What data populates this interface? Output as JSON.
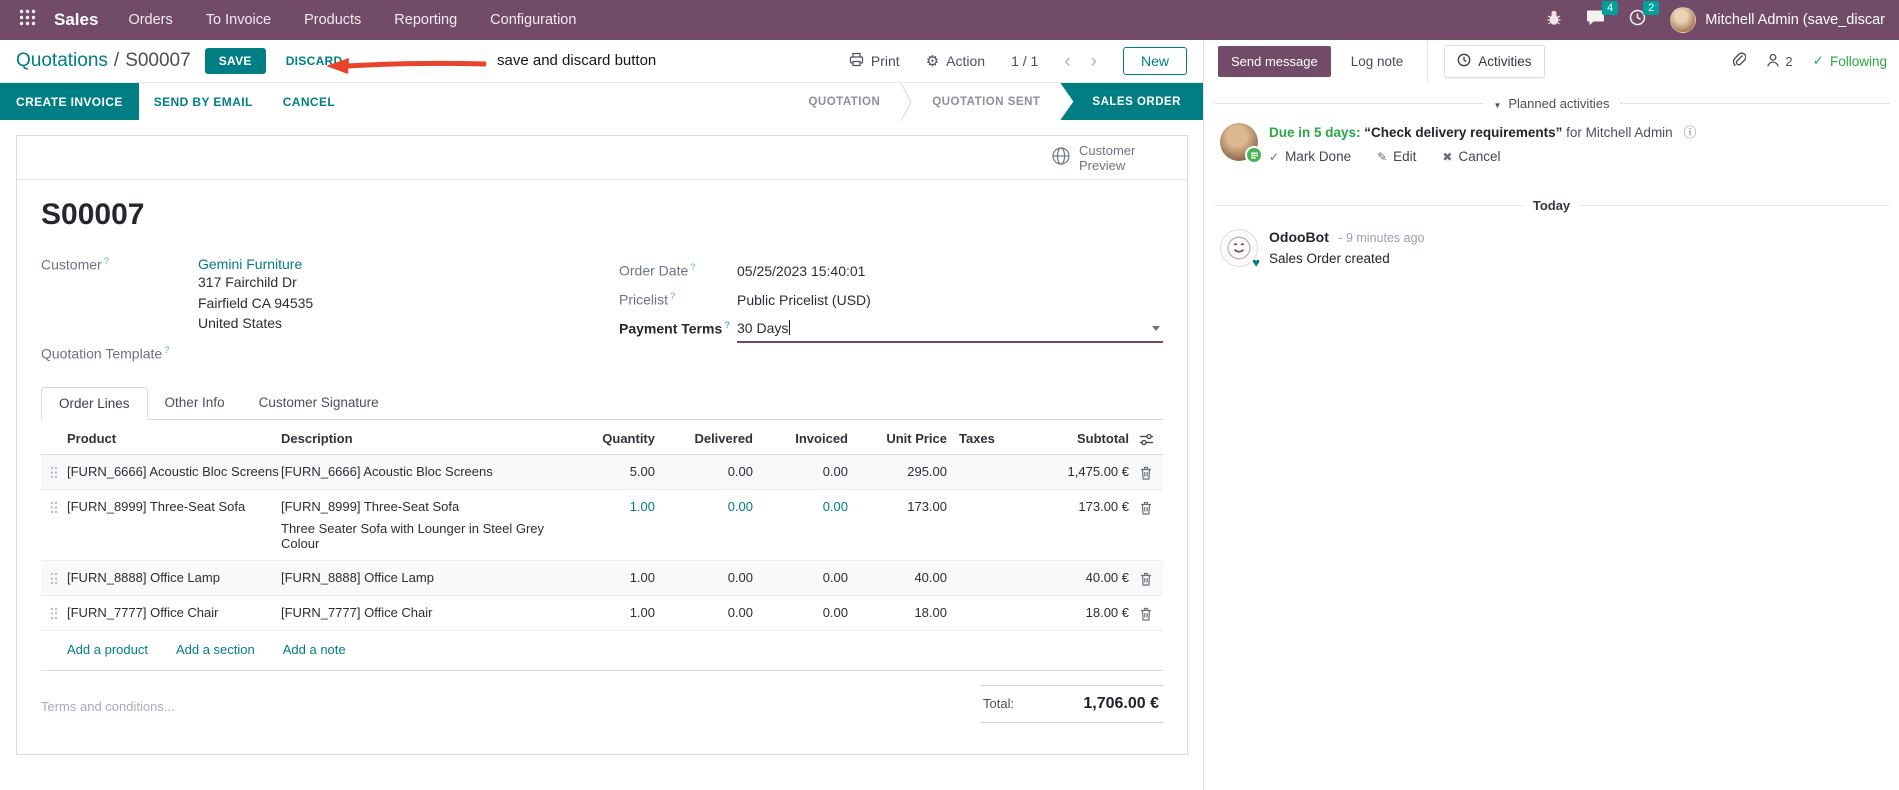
{
  "colors": {
    "brand_purple": "#714B67",
    "accent_teal": "#017e84",
    "badge_teal": "#00a09d",
    "success_green": "#28a745",
    "annotation_red": "#e8432d"
  },
  "icons": {
    "gear": "⚙",
    "chevron_left": "‹",
    "chevron_right": "›",
    "check": "✓",
    "pencil": "✎",
    "cross": "✖",
    "info": "ⓘ",
    "caret_down": "▼",
    "heart": "♥"
  },
  "topnav": {
    "app_name": "Sales",
    "menus": [
      "Orders",
      "To Invoice",
      "Products",
      "Reporting",
      "Configuration"
    ],
    "message_badge": "4",
    "activity_badge": "2",
    "user_name": "Mitchell Admin (save_discar"
  },
  "control_panel": {
    "breadcrumb_parent": "Quotations",
    "breadcrumb_separator": "/",
    "breadcrumb_current": "S00007",
    "save": "SAVE",
    "discard": "DISCARD",
    "print": "Print",
    "action": "Action",
    "pager": "1 / 1",
    "new": "New"
  },
  "annotation": {
    "text": "save and discard button"
  },
  "statusbar": {
    "create_invoice": "CREATE INVOICE",
    "send_by_email": "SEND BY EMAIL",
    "cancel": "CANCEL",
    "stages": [
      {
        "label": "QUOTATION"
      },
      {
        "label": "QUOTATION SENT"
      },
      {
        "label": "SALES ORDER"
      }
    ]
  },
  "form": {
    "customer_preview": "Customer Preview",
    "title": "S00007",
    "help_marker": "?",
    "customer": {
      "label": "Customer",
      "name": "Gemini Furniture",
      "address": [
        "317 Fairchild Dr",
        "Fairfield CA 94535",
        "United States"
      ]
    },
    "quotation_template_label": "Quotation Template",
    "details": [
      {
        "label": "Order Date",
        "value": "05/25/2023 15:40:01"
      },
      {
        "label": "Pricelist",
        "value": "Public Pricelist (USD)"
      },
      {
        "label": "Payment Terms",
        "value": "30 Days"
      }
    ],
    "tabs": [
      "Order Lines",
      "Other Info",
      "Customer Signature"
    ]
  },
  "order_lines": {
    "columns": [
      "Product",
      "Description",
      "Quantity",
      "Delivered",
      "Invoiced",
      "Unit Price",
      "Taxes",
      "Subtotal"
    ],
    "rows": [
      {
        "product": "[FURN_6666] Acoustic Bloc Screens",
        "description": "[FURN_6666] Acoustic Bloc Screens",
        "quantity": "5.00",
        "delivered": "0.00",
        "invoiced": "0.00",
        "unit_price": "295.00",
        "subtotal": "1,475.00 €"
      },
      {
        "product": "[FURN_8999] Three-Seat Sofa",
        "description": "[FURN_8999] Three-Seat Sofa",
        "description_line2": "Three Seater Sofa with Lounger in Steel Grey Colour",
        "quantity": "1.00",
        "delivered": "0.00",
        "invoiced": "0.00",
        "unit_price": "173.00",
        "subtotal": "173.00 €"
      },
      {
        "product": "[FURN_8888] Office Lamp",
        "description": "[FURN_8888] Office Lamp",
        "quantity": "1.00",
        "delivered": "0.00",
        "invoiced": "0.00",
        "unit_price": "40.00",
        "subtotal": "40.00 €"
      },
      {
        "product": "[FURN_7777] Office Chair",
        "description": "[FURN_7777] Office Chair",
        "quantity": "1.00",
        "delivered": "0.00",
        "invoiced": "0.00",
        "unit_price": "18.00",
        "subtotal": "18.00 €"
      }
    ],
    "links": [
      "Add a product",
      "Add a section",
      "Add a note"
    ],
    "terms_placeholder": "Terms and conditions...",
    "total_label": "Total:",
    "total_value": "1,706.00 €"
  },
  "chatter": {
    "send_message": "Send message",
    "log_note": "Log note",
    "activities": "Activities",
    "followers_count": "2",
    "following": "Following",
    "planned_activities": "Planned activities",
    "activity": {
      "due": "Due in 5 days:",
      "title": "“Check delivery requirements”",
      "assignee": "for Mitchell Admin",
      "mark_done": "Mark Done",
      "edit": "Edit",
      "cancel": "Cancel"
    },
    "today": "Today",
    "message": {
      "author": "OdooBot",
      "time": "- 9 minutes ago",
      "body": "Sales Order created"
    }
  }
}
